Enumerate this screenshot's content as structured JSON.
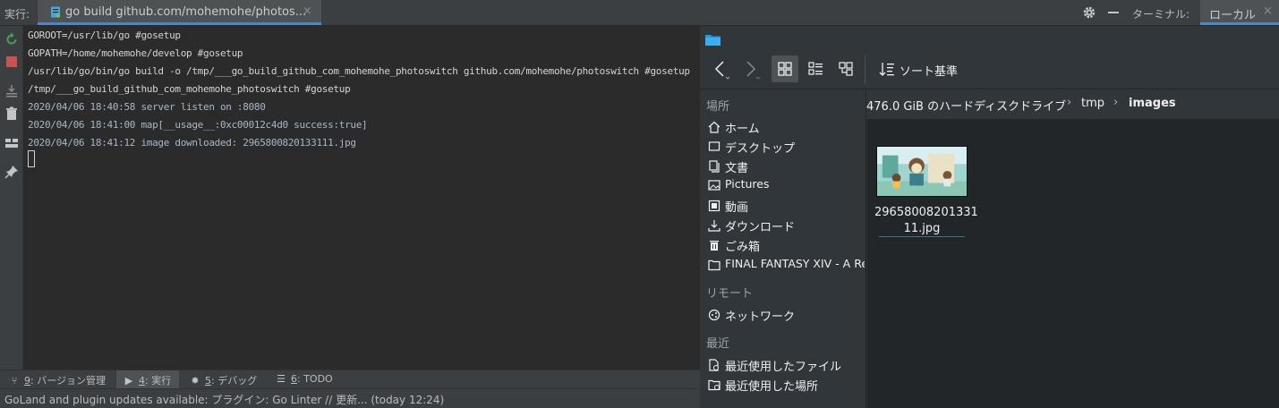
{
  "ide": {
    "run_label": "実行:",
    "run_tab_title": "go build github.com/mohemohe/photos...",
    "close_glyph": "×",
    "terminal_label": "ターミナル:",
    "terminal_tab": "ローカル",
    "console_lines": [
      "GOROOT=/usr/lib/go #gosetup",
      "GOPATH=/home/mohemohe/develop #gosetup",
      "/usr/lib/go/bin/go build -o /tmp/___go_build_github_com_mohemohe_photoswitch github.com/mohemohe/photoswitch #gosetup",
      "/tmp/___go_build_github_com_mohemohe_photoswitch #gosetup",
      "2020/04/06 18:40:58 server listen on :8080",
      "2020/04/06 18:41:00 map[__usage__:0xc00012c4d0 success:true]",
      "2020/04/06 18:41:12 image downloaded: 2965800820133111.jpg"
    ],
    "bottom_tabs": [
      {
        "num": "9",
        "label": ": バージョン管理"
      },
      {
        "num": "4",
        "label": ": 実行"
      },
      {
        "num": "5",
        "label": ": デバッグ"
      },
      {
        "num": "6",
        "label": ": TODO"
      }
    ],
    "status_text": "GoLand and plugin updates available: プラグイン: Go Linter // 更新... (today 12:24)",
    "colors": {
      "accent": "#4a88c7",
      "rerun": "#499c54",
      "stop": "#c75450"
    }
  },
  "file_manager": {
    "sort_label": "ソート基準",
    "sections": {
      "places": "場所",
      "remote": "リモート",
      "recent": "最近"
    },
    "places": [
      {
        "icon": "home-icon",
        "label": "ホーム"
      },
      {
        "icon": "desktop-icon",
        "label": "デスクトップ"
      },
      {
        "icon": "documents-icon",
        "label": "文書"
      },
      {
        "icon": "pictures-icon",
        "label": "Pictures"
      },
      {
        "icon": "video-icon",
        "label": "動画"
      },
      {
        "icon": "download-icon",
        "label": "ダウンロード"
      },
      {
        "icon": "trash-icon",
        "label": "ごみ箱"
      },
      {
        "icon": "folder-icon",
        "label": "FINAL FANTASY XIV - A Re"
      }
    ],
    "remote": [
      {
        "icon": "network-icon",
        "label": "ネットワーク"
      }
    ],
    "recent": [
      {
        "icon": "recent-files-icon",
        "label": "最近使用したファイル"
      },
      {
        "icon": "recent-locations-icon",
        "label": "最近使用した場所"
      }
    ],
    "breadcrumb": [
      "476.0 GiB のハードディスクドライブ",
      "tmp",
      "images"
    ],
    "breadcrumb_sep": "›",
    "files": [
      {
        "name_line1": "29658008201331",
        "name_line2": "11.jpg"
      }
    ],
    "colors": {
      "selection": "#3daee9",
      "folder": "#1d99f3"
    }
  }
}
